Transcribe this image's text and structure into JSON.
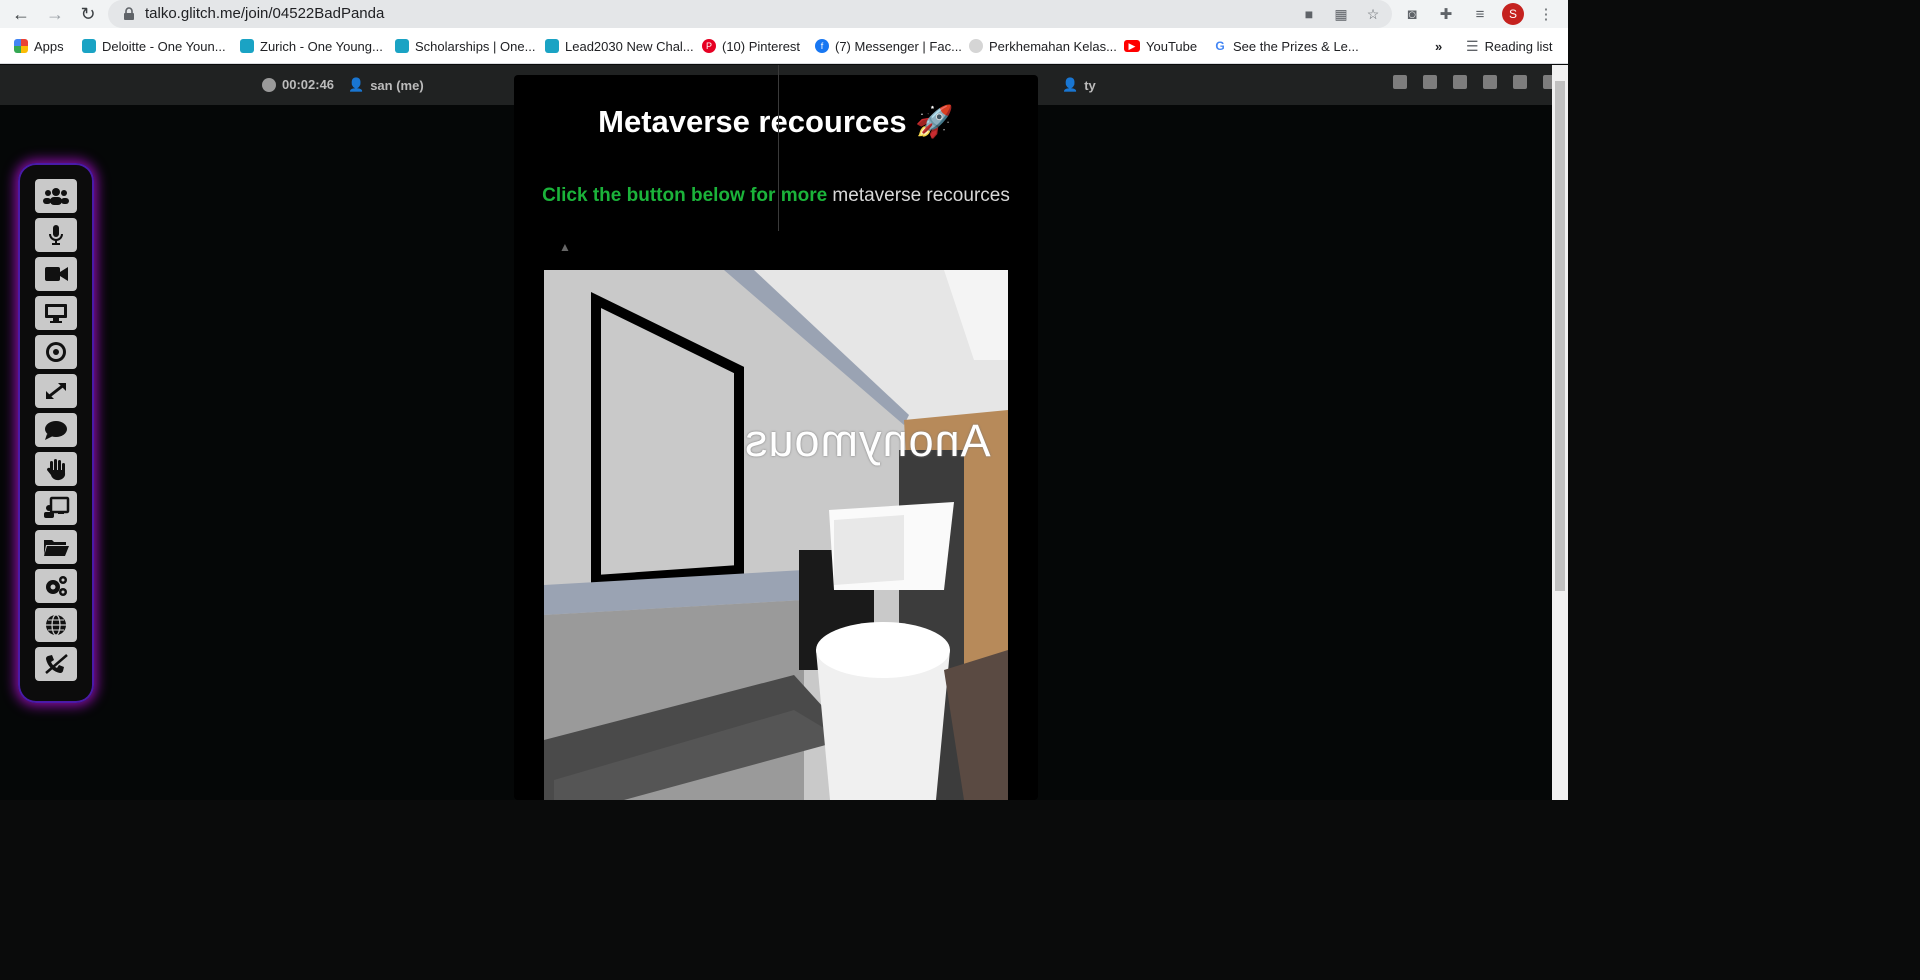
{
  "browser": {
    "url": "talko.glitch.me/join/04522BadPanda",
    "avatar_letter": "S",
    "reading_list": "Reading list",
    "bookmarks": [
      {
        "label": "Apps",
        "icon": "apps-grid-icon",
        "color": "#4285f4"
      },
      {
        "label": "Deloitte - One Youn...",
        "icon": "one-young-world-icon",
        "color": "#1aa3c4"
      },
      {
        "label": "Zurich - One Young...",
        "icon": "one-young-world-icon",
        "color": "#1aa3c4"
      },
      {
        "label": "Scholarships | One...",
        "icon": "one-young-world-icon",
        "color": "#1aa3c4"
      },
      {
        "label": "Lead2030 New Chal...",
        "icon": "one-young-world-icon",
        "color": "#1aa3c4"
      },
      {
        "label": "(10) Pinterest",
        "icon": "pinterest-icon",
        "color": "#e60023"
      },
      {
        "label": "(7) Messenger | Fac...",
        "icon": "facebook-icon",
        "color": "#1877f2"
      },
      {
        "label": "Perkhemahan Kelas...",
        "icon": "site-icon",
        "color": "#bdbdbd"
      },
      {
        "label": "YouTube",
        "icon": "youtube-icon",
        "color": "#ff0000"
      },
      {
        "label": "See the Prizes & Le...",
        "icon": "google-icon",
        "color": "#4285f4"
      }
    ],
    "more": "»"
  },
  "header": {
    "timer": "00:02:46",
    "self_name": "san (me)",
    "peer_name": "ty"
  },
  "sidebar": {
    "buttons": [
      "participants-icon",
      "microphone-icon",
      "video-camera-icon",
      "screen-share-icon",
      "record-icon",
      "fullscreen-icon",
      "chat-icon",
      "raise-hand-icon",
      "whiteboard-icon",
      "file-share-icon",
      "settings-icon",
      "globe-icon",
      "hang-up-icon"
    ],
    "accent": "#8a0ea8"
  },
  "modal": {
    "title": "Metaverse recources 🚀",
    "subtitle_highlight": "Click the button below for more",
    "subtitle_rest": " metaverse recources"
  },
  "scene": {
    "name_label": "Anonymous"
  }
}
